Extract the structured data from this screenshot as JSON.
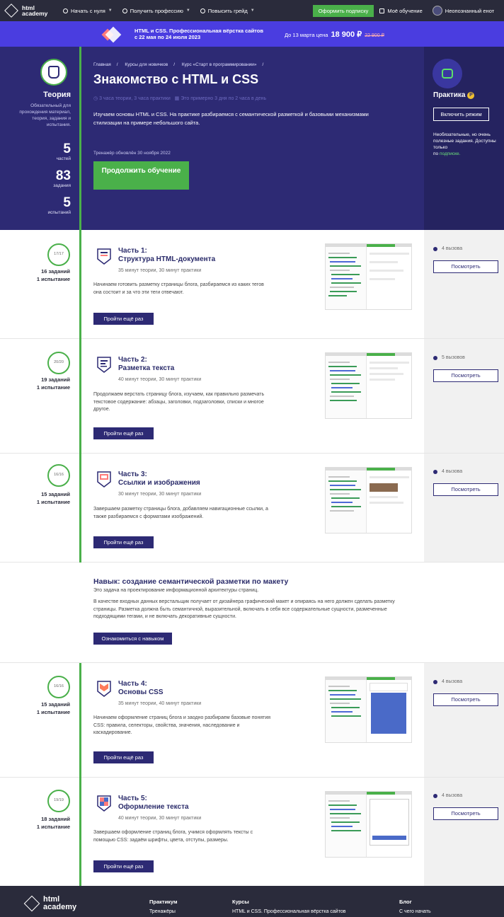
{
  "topnav": {
    "logo_line1": "html",
    "logo_line2": "academy",
    "items": [
      "Начать с нуля",
      "Получить профессию",
      "Повысить грейд"
    ],
    "subscribe": "Оформить подписку",
    "my_learning": "Моё обучение",
    "user": "Неопознанный енот"
  },
  "promo": {
    "title": "HTML и CSS. Профессиональная вёрстка сайтов",
    "dates": "с 22 мая по 24 июля 2023",
    "price_label": "До 13 марта цена",
    "price": "18 900 ₽",
    "old_price": "22 900 ₽"
  },
  "hero": {
    "breadcrumbs": [
      "Главная",
      "Курсы для новичков",
      "Курс «Старт в программировании»"
    ],
    "title": "Знакомство с HTML и CSS",
    "meta_time": "3 часа теории, 3 часа практики",
    "meta_days": "Это примерно 3 дня по 2 часа в день",
    "description": "Изучаем основы HTML и CSS. На практике разбираемся с семантической разметкой и базовыми механизмами стилизации на примере небольшого сайта.",
    "updated": "Тренажёр обновлён 30 ноября 2022",
    "continue_btn": "Продолжить обучение"
  },
  "theory": {
    "title": "Теория",
    "desc": "Обязательный для прохождения материал, теория, задания и испытания.",
    "parts_n": "5",
    "parts_l": "частей",
    "tasks_n": "83",
    "tasks_l": "задания",
    "tests_n": "5",
    "tests_l": "испытаний"
  },
  "practice": {
    "title": "Практика",
    "badge": "P",
    "enable_btn": "Включить режим",
    "note": "Необязательные, но очень полезные задания. Доступны только",
    "note_prefix": "по",
    "note_link": "подписке."
  },
  "parts": [
    {
      "progress": "17/17",
      "tasks": "16 заданий",
      "tests": "1 испытание",
      "num": "Часть 1:",
      "name": "Структура HTML-документа",
      "meta": "35 минут теории, 30 минут практики",
      "desc": "Начинаем готовить разметку страницы блога, разбираемся из каких тегов она состоит и за что эти теги отвечают.",
      "btn": "Пройти ещё раз",
      "calls": "4 вызова",
      "view": "Посмотреть"
    },
    {
      "progress": "20/20",
      "tasks": "19 заданий",
      "tests": "1 испытание",
      "num": "Часть 2:",
      "name": "Разметка текста",
      "meta": "40 минут теории, 30 минут практики",
      "desc": "Продолжаем верстать страницу блога, изучаем, как правильно размечать текстовое содержание: абзацы, заголовки, подзаголовки, списки и многое другое.",
      "btn": "Пройти ещё раз",
      "calls": "5 вызовов",
      "view": "Посмотреть"
    },
    {
      "progress": "16/16",
      "tasks": "15 заданий",
      "tests": "1 испытание",
      "num": "Часть 3:",
      "name": "Ссылки и изображения",
      "meta": "30 минут теории, 30 минут практики",
      "desc": "Завершаем разметку страницы блога, добавляем навигационные ссылки, а также разбираемся с форматами изображений.",
      "btn": "Пройти ещё раз",
      "calls": "4 вызова",
      "view": "Посмотреть"
    },
    {
      "progress": "16/16",
      "tasks": "15 заданий",
      "tests": "1 испытание",
      "num": "Часть 4:",
      "name": "Основы CSS",
      "meta": "35 минут теории, 40 минут практики",
      "desc": "Начинаем оформление страниц блога и заодно разбираем базовые понятия CSS: правила, селекторы, свойства, значения, наследование и каскадирование.",
      "btn": "Пройти ещё раз",
      "calls": "4 вызова",
      "view": "Посмотреть"
    },
    {
      "progress": "19/19",
      "tasks": "18 заданий",
      "tests": "1 испытание",
      "num": "Часть 5:",
      "name": "Оформление текста",
      "meta": "40 минут теории, 30 минут практики",
      "desc": "Завершаем оформление страниц блога, учимся оформлять тексты с помощью CSS: задаём шрифты, цвета, отступы, размеры.",
      "btn": "Пройти ещё раз",
      "calls": "4 вызова",
      "view": "Посмотреть"
    }
  ],
  "skill": {
    "title": "Навык: создание семантической разметки по макету",
    "subtitle": "Это задача на проектирование информационной архитектуры страниц.",
    "desc": "В качестве входных данных верстальщик получает от дизайнера графический макет и опираясь на него должен сделать разметку страницы. Разметка должна быть семантичной, выразительной, включать в себя все содержательные сущности, размеченные подходящими тегами, и не включать декоративные сущности.",
    "btn": "Ознакомиться с навыком"
  },
  "footer": {
    "logo_line1": "html",
    "logo_line2": "academy",
    "col1_h": "Практикум",
    "col1_i": "Тренажёры",
    "col2_h": "Курсы",
    "col2_i": "HTML и CSS. Профессиональная вёрстка сайтов",
    "col3_h": "Блог",
    "col3_i": "С чего начать"
  }
}
